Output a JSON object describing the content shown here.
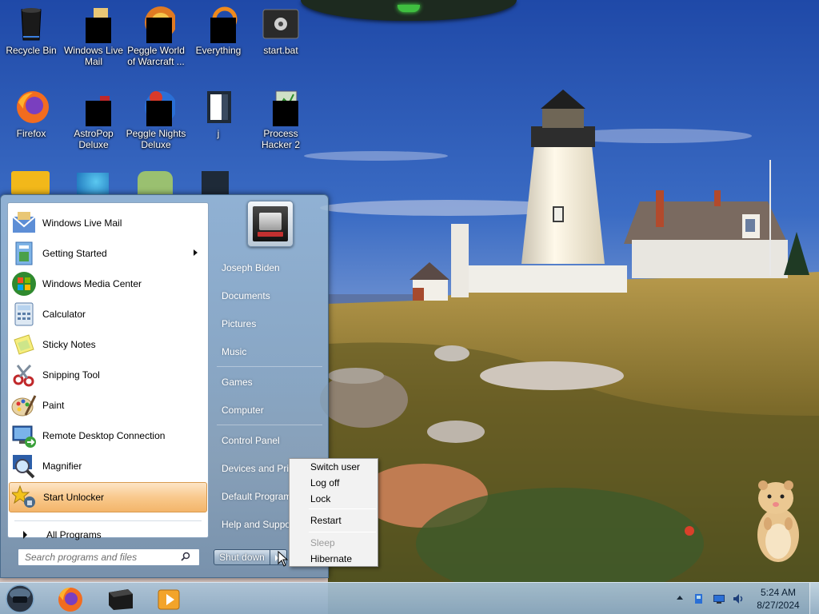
{
  "desktop": {
    "icons": [
      {
        "label": "Recycle Bin"
      },
      {
        "label": "Windows Live Mail"
      },
      {
        "label": "Peggle World of Warcraft ..."
      },
      {
        "label": "Everything"
      },
      {
        "label": "start.bat"
      },
      {
        "label": "Firefox"
      },
      {
        "label": "AstroPop Deluxe"
      },
      {
        "label": "Peggle Nights Deluxe"
      },
      {
        "label": "j"
      },
      {
        "label": "Process Hacker 2"
      }
    ]
  },
  "start_menu": {
    "programs": [
      {
        "label": "Windows Live Mail",
        "icon": "mail-icon"
      },
      {
        "label": "Getting Started",
        "icon": "getting-started-icon",
        "has_submenu": true
      },
      {
        "label": "Windows Media Center",
        "icon": "media-center-icon"
      },
      {
        "label": "Calculator",
        "icon": "calculator-icon"
      },
      {
        "label": "Sticky Notes",
        "icon": "sticky-notes-icon"
      },
      {
        "label": "Snipping Tool",
        "icon": "scissors-icon"
      },
      {
        "label": "Paint",
        "icon": "paint-palette-icon"
      },
      {
        "label": "Remote Desktop Connection",
        "icon": "remote-desktop-icon"
      },
      {
        "label": "Magnifier",
        "icon": "magnifier-icon"
      },
      {
        "label": "Start Unlocker",
        "icon": "unlocker-icon",
        "highlighted": true
      }
    ],
    "all_programs": "All Programs",
    "search_placeholder": "Search programs and files",
    "right_items": [
      "Joseph Biden",
      "Documents",
      "Pictures",
      "Music",
      "Games",
      "Computer",
      "Control Panel",
      "Devices and Printers",
      "Default Programs",
      "Help and Support"
    ],
    "shutdown_label": "Shut down"
  },
  "power_menu": {
    "items": [
      {
        "label": "Switch user",
        "enabled": true
      },
      {
        "label": "Log off",
        "enabled": true
      },
      {
        "label": "Lock",
        "enabled": true
      },
      {
        "label": "Restart",
        "enabled": true
      },
      {
        "label": "Sleep",
        "enabled": false
      },
      {
        "label": "Hibernate",
        "enabled": true
      }
    ]
  },
  "taskbar": {
    "apps": [
      "firefox-icon",
      "terminal-icon",
      "media-player-icon"
    ],
    "tray_icons": [
      "network-icon",
      "display-icon",
      "volume-icon"
    ],
    "time": "5:24 AM",
    "date": "8/27/2024"
  },
  "colors": {
    "highlight": "#f9c98d",
    "taskbar": "#a9c1d6"
  }
}
